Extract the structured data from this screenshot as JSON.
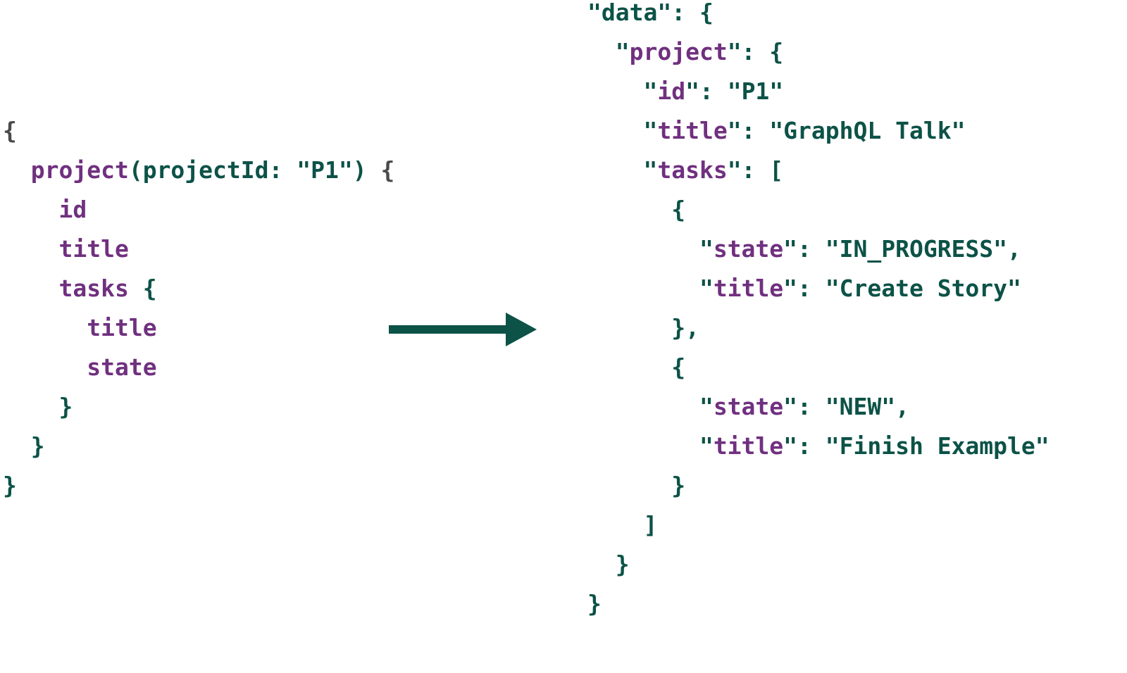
{
  "colors": {
    "keyword": "#70307f",
    "text": "#0c5247",
    "brace_query": "#4a4a4a",
    "arrow": "#0c5247"
  },
  "query": {
    "lines": [
      [
        {
          "t": "{",
          "c": "brace_query"
        }
      ],
      [
        {
          "t": "  ",
          "c": "text"
        },
        {
          "t": "project",
          "c": "keyword"
        },
        {
          "t": "(projectId: \"P1\") ",
          "c": "text"
        },
        {
          "t": "{",
          "c": "brace_query"
        }
      ],
      [
        {
          "t": "    ",
          "c": "text"
        },
        {
          "t": "id",
          "c": "keyword"
        }
      ],
      [
        {
          "t": "    ",
          "c": "text"
        },
        {
          "t": "title",
          "c": "keyword"
        }
      ],
      [
        {
          "t": "    ",
          "c": "text"
        },
        {
          "t": "tasks",
          "c": "keyword"
        },
        {
          "t": " {",
          "c": "text"
        }
      ],
      [
        {
          "t": "      ",
          "c": "text"
        },
        {
          "t": "title",
          "c": "keyword"
        }
      ],
      [
        {
          "t": "      ",
          "c": "text"
        },
        {
          "t": "state",
          "c": "keyword"
        }
      ],
      [
        {
          "t": "    }",
          "c": "text"
        }
      ],
      [
        {
          "t": "  }",
          "c": "text"
        }
      ],
      [
        {
          "t": "}",
          "c": "text"
        }
      ]
    ]
  },
  "arrow_icon": "arrow-right",
  "response": {
    "lines": [
      [
        {
          "t": "\"data\": {",
          "c": "text"
        }
      ],
      [
        {
          "t": "  \"",
          "c": "text"
        },
        {
          "t": "project",
          "c": "keyword"
        },
        {
          "t": "\": {",
          "c": "text"
        }
      ],
      [
        {
          "t": "    \"",
          "c": "text"
        },
        {
          "t": "id",
          "c": "keyword"
        },
        {
          "t": "\": \"P1\"",
          "c": "text"
        }
      ],
      [
        {
          "t": "    \"",
          "c": "text"
        },
        {
          "t": "title",
          "c": "keyword"
        },
        {
          "t": "\": \"GraphQL Talk\"",
          "c": "text"
        }
      ],
      [
        {
          "t": "    \"",
          "c": "text"
        },
        {
          "t": "tasks",
          "c": "keyword"
        },
        {
          "t": "\": [",
          "c": "text"
        }
      ],
      [
        {
          "t": "      {",
          "c": "text"
        }
      ],
      [
        {
          "t": "        \"",
          "c": "text"
        },
        {
          "t": "state",
          "c": "keyword"
        },
        {
          "t": "\": \"IN_PROGRESS\",",
          "c": "text"
        }
      ],
      [
        {
          "t": "        \"",
          "c": "text"
        },
        {
          "t": "title",
          "c": "keyword"
        },
        {
          "t": "\": \"Create Story\"",
          "c": "text"
        }
      ],
      [
        {
          "t": "      },",
          "c": "text"
        }
      ],
      [
        {
          "t": "      {",
          "c": "text"
        }
      ],
      [
        {
          "t": "        \"",
          "c": "text"
        },
        {
          "t": "state",
          "c": "keyword"
        },
        {
          "t": "\": \"NEW\",",
          "c": "text"
        }
      ],
      [
        {
          "t": "        \"",
          "c": "text"
        },
        {
          "t": "title",
          "c": "keyword"
        },
        {
          "t": "\": \"Finish Example\"",
          "c": "text"
        }
      ],
      [
        {
          "t": "      }",
          "c": "text"
        }
      ],
      [
        {
          "t": "    ]",
          "c": "text"
        }
      ],
      [
        {
          "t": "  }",
          "c": "text"
        }
      ],
      [
        {
          "t": "}",
          "c": "text"
        }
      ]
    ]
  }
}
